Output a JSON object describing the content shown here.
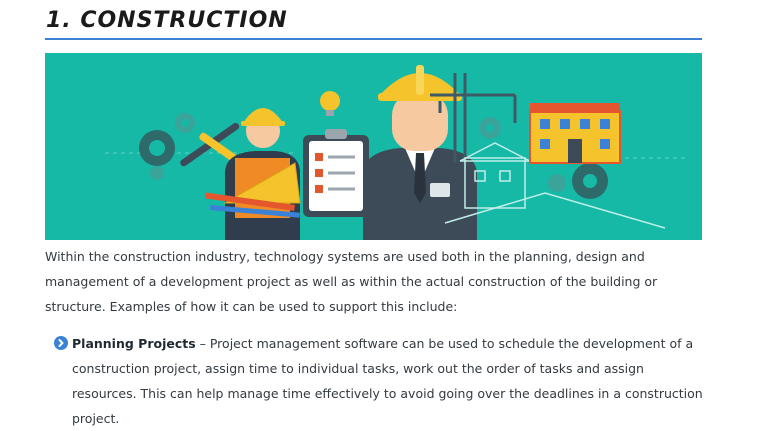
{
  "section": {
    "title": "1. CONSTRUCTION"
  },
  "intro_text": "Within the construction industry, technology systems are used both in the planning, design and management of a development project as well as within the actual construction of the building or structure. Examples of how it can be used to support this include:",
  "list_items": [
    {
      "title": "Planning Projects",
      "text": " – Project management software can be used to schedule the development of a construction project, assign time to individual tasks, work out the order of tasks and assign resources. This can help manage time effectively to avoid going over the deadlines in a construction project."
    }
  ],
  "colors": {
    "banner_bg": "#16b9a6",
    "rule": "#3b82d6",
    "bullet": "#3b82d6"
  }
}
